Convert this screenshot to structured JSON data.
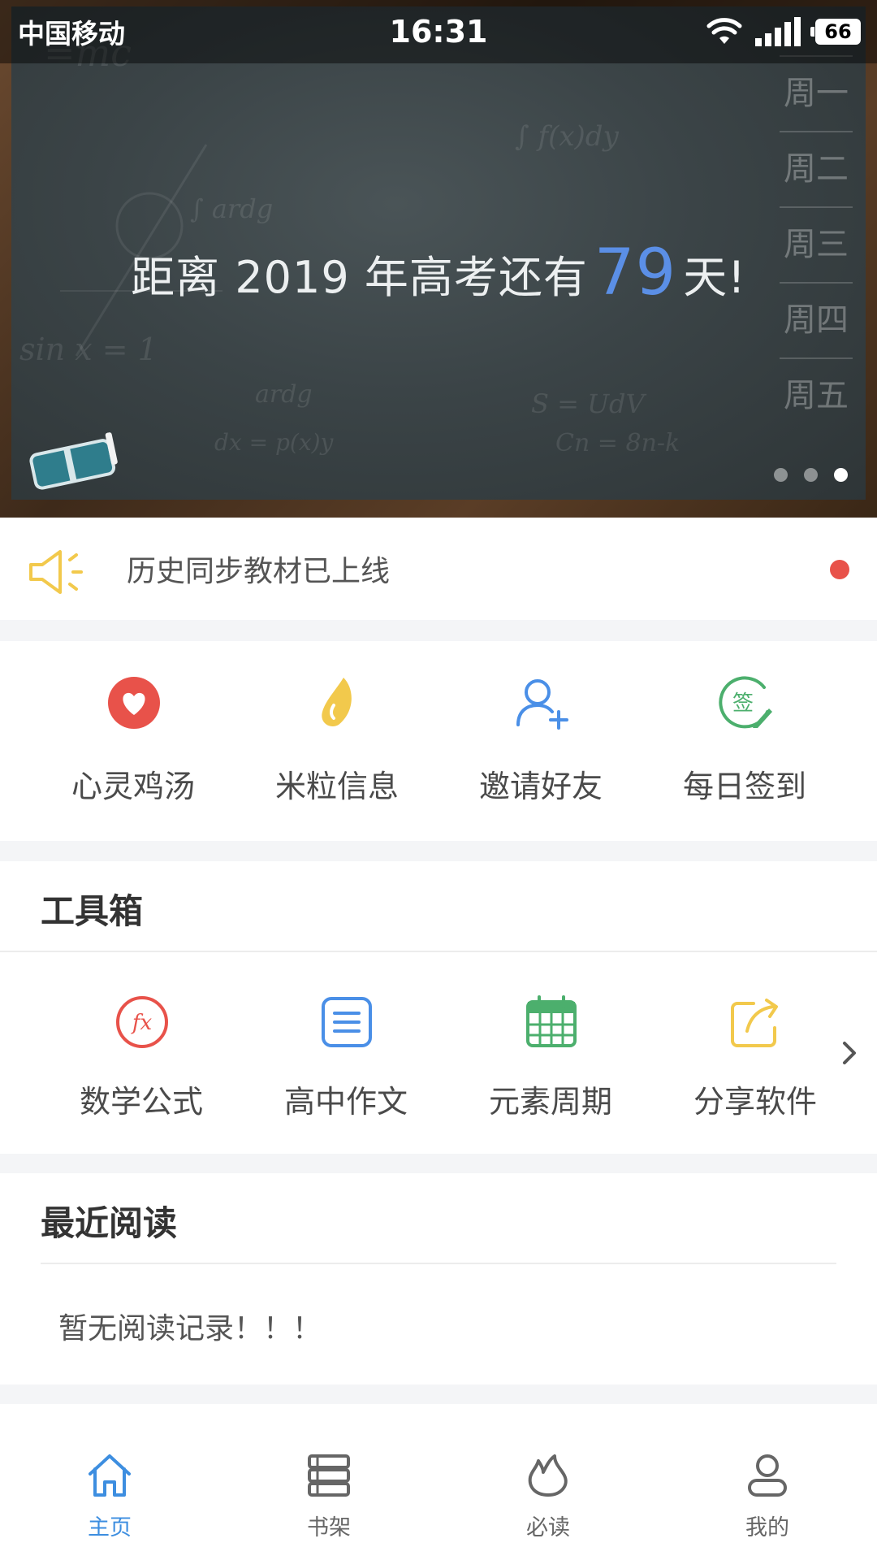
{
  "status_bar": {
    "carrier": "中国移动",
    "time": "16:31",
    "battery": "66"
  },
  "banner": {
    "countdown_prefix": "距离 2019 年高考还有",
    "days": "79",
    "countdown_suffix": "天!",
    "weekdays": [
      "周一",
      "周二",
      "周三",
      "周四",
      "周五"
    ],
    "pager": {
      "count": 3,
      "active_index": 2
    },
    "accent": "#5b8fe6"
  },
  "notice": {
    "text": "历史同步教材已上线",
    "speaker_color": "#f2c94c",
    "dot_color": "#e8524a"
  },
  "quick_actions": [
    {
      "label": "心灵鸡汤",
      "icon": "heart-icon",
      "color": "#e8524a"
    },
    {
      "label": "米粒信息",
      "icon": "rice-grain-icon",
      "color": "#f2c94c"
    },
    {
      "label": "邀请好友",
      "icon": "add-user-icon",
      "color": "#4a8fe7"
    },
    {
      "label": "每日签到",
      "icon": "sign-in-icon",
      "color": "#4caf6d"
    }
  ],
  "toolbox": {
    "title": "工具箱",
    "items": [
      {
        "label": "数学公式",
        "icon": "formula-icon",
        "color": "#e8524a"
      },
      {
        "label": "高中作文",
        "icon": "document-icon",
        "color": "#4a8fe7"
      },
      {
        "label": "元素周期",
        "icon": "calendar-grid-icon",
        "color": "#4caf6d"
      },
      {
        "label": "分享软件",
        "icon": "share-icon",
        "color": "#f2c94c"
      }
    ]
  },
  "recent": {
    "title": "最近阅读",
    "empty_text": "暂无阅读记录！！！"
  },
  "tabbar": {
    "active_color": "#3d8ee0",
    "tabs": [
      {
        "label": "主页",
        "icon": "home-icon",
        "active": true
      },
      {
        "label": "书架",
        "icon": "bookshelf-icon",
        "active": false
      },
      {
        "label": "必读",
        "icon": "flame-icon",
        "active": false
      },
      {
        "label": "我的",
        "icon": "profile-icon",
        "active": false
      }
    ]
  }
}
